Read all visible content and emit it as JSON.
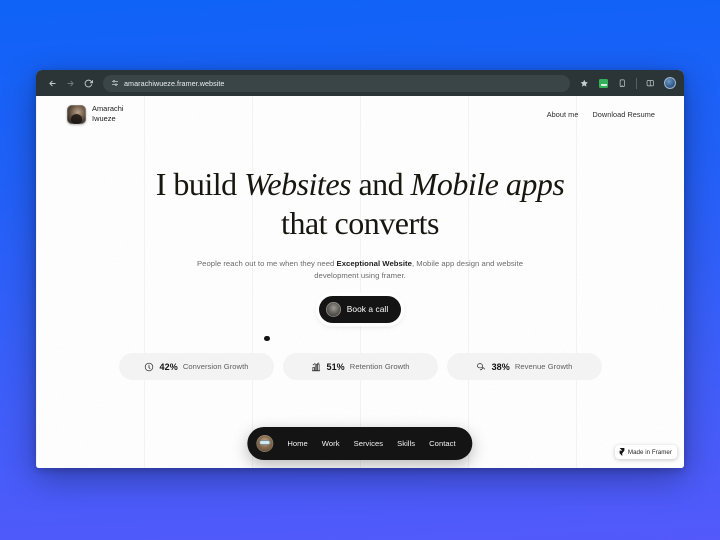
{
  "browser": {
    "url": "amarachiwueze.framer.website",
    "back_label": "Back",
    "forward_label": "Forward",
    "reload_label": "Reload",
    "site_settings_label": "View site information",
    "bookmark_label": "Bookmark this tab",
    "extension_label": "Extension",
    "device_toolbar_label": "Device toolbar",
    "split_label": "Split view",
    "profile_label": "Profile"
  },
  "site": {
    "header": {
      "brand_first": "Amarachi",
      "brand_last": "Iwueze",
      "nav": [
        {
          "label": "About me"
        },
        {
          "label": "Download Resume"
        }
      ]
    },
    "hero": {
      "headline_part1": "I build ",
      "headline_em1": "Websites",
      "headline_part2": " and ",
      "headline_em2": "Mobile apps",
      "headline_part3": " that converts",
      "sub_part1": "People reach out to me when they need ",
      "sub_bold": "Exceptional Website",
      "sub_part2": ", Mobile app design and website development using framer.",
      "cta_label": "Book a call"
    },
    "stats": [
      {
        "value": "42%",
        "label": "Conversion Growth",
        "icon": "target-icon"
      },
      {
        "value": "51%",
        "label": "Retention Growth",
        "icon": "bar-chart-icon"
      },
      {
        "value": "38%",
        "label": "Revenue Growth",
        "icon": "coins-icon"
      }
    ],
    "pill_nav": [
      {
        "label": "Home"
      },
      {
        "label": "Work"
      },
      {
        "label": "Services"
      },
      {
        "label": "Skills"
      },
      {
        "label": "Contact"
      }
    ],
    "framer_badge": {
      "label": "Made in Framer"
    }
  },
  "colors": {
    "page_bg_top": "#0f63f7",
    "page_bg_bottom": "#5359fa",
    "chrome_bar": "#2b3538",
    "omnibox": "#3a4548",
    "dark_pill": "#141414",
    "stat_card": "#f3f3f3",
    "extension_green": "#35b05a"
  }
}
